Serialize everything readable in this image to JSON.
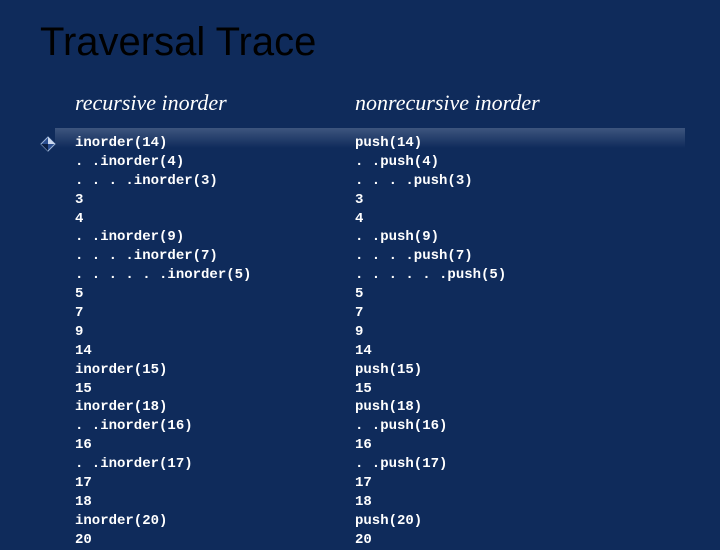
{
  "title": "Traversal Trace",
  "left": {
    "header": "recursive inorder",
    "lines": [
      "inorder(14)",
      ". .inorder(4)",
      ". . . .inorder(3)",
      "3",
      "4",
      ". .inorder(9)",
      ". . . .inorder(7)",
      ". . . . . .inorder(5)",
      "5",
      "7",
      "9",
      "14",
      "inorder(15)",
      "15",
      "inorder(18)",
      ". .inorder(16)",
      "16",
      ". .inorder(17)",
      "17",
      "18",
      "inorder(20)",
      "20"
    ]
  },
  "right": {
    "header": "nonrecursive inorder",
    "lines": [
      "push(14)",
      ". .push(4)",
      ". . . .push(3)",
      "3",
      "4",
      ". .push(9)",
      ". . . .push(7)",
      ". . . . . .push(5)",
      "5",
      "7",
      "9",
      "14",
      "push(15)",
      "15",
      "push(18)",
      ". .push(16)",
      "16",
      ". .push(17)",
      "17",
      "18",
      "push(20)",
      "20"
    ]
  }
}
